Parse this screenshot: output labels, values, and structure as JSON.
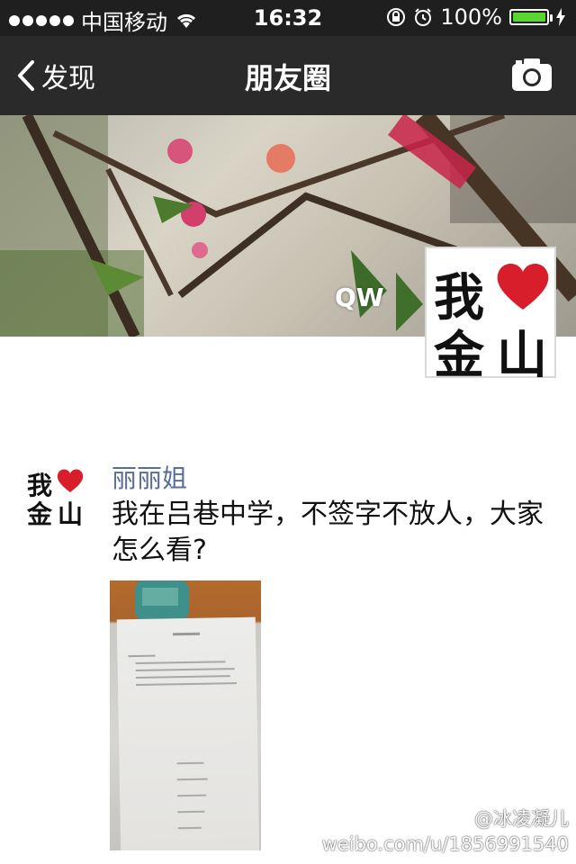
{
  "status_bar": {
    "carrier": "中国移动",
    "time": "16:32",
    "battery_percent": "100%",
    "battery_level": 1.0,
    "signal_dots": 5
  },
  "nav": {
    "back_label": "发现",
    "title": "朋友圈",
    "camera_icon": "camera-icon"
  },
  "cover": {
    "watermark": "QW"
  },
  "logo": {
    "line1_left": "我",
    "line2_left": "金",
    "line2_right": "山",
    "heart_color": "#d81e2a"
  },
  "post": {
    "author": "丽丽姐",
    "text": "我在吕巷中学，不签字不放人，大家怎么看?"
  },
  "watermark": {
    "weibo_user": "@冰凌凝儿",
    "weibo_url": "weibo.com/u/1856991540"
  }
}
